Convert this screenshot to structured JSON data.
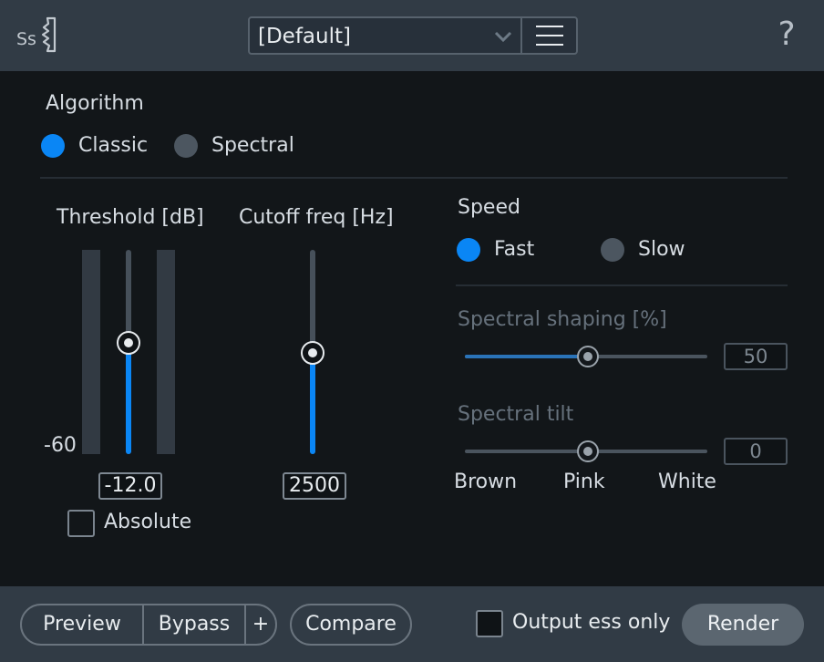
{
  "header": {
    "preset_name": "[Default]",
    "help_glyph": "?",
    "logo_icon": "de-esser-logo-icon",
    "chevron_icon": "chevron-down-icon",
    "menu_icon": "hamburger-menu-icon"
  },
  "algorithm": {
    "title": "Algorithm",
    "options": [
      {
        "label": "Classic",
        "selected": true
      },
      {
        "label": "Spectral",
        "selected": false
      }
    ]
  },
  "threshold": {
    "title": "Threshold [dB]",
    "meter_label": "-60",
    "value": "-12.0",
    "absolute_label": "Absolute",
    "absolute_checked": false
  },
  "cutoff": {
    "title": "Cutoff freq [Hz]",
    "value": "2500"
  },
  "speed": {
    "title": "Speed",
    "options": [
      {
        "label": "Fast",
        "selected": true
      },
      {
        "label": "Slow",
        "selected": false
      }
    ]
  },
  "spectral_shaping": {
    "title": "Spectral shaping [%]",
    "value": "50",
    "level_fraction": 0.5
  },
  "spectral_tilt": {
    "title": "Spectral tilt",
    "value": "0",
    "level_fraction": 0.5,
    "scale_labels": [
      "Brown",
      "Pink",
      "White"
    ]
  },
  "footer": {
    "preview_label": "Preview",
    "bypass_label": "Bypass",
    "plus_label": "+",
    "compare_label": "Compare",
    "output_ess_label": "Output ess only",
    "output_ess_checked": false,
    "render_label": "Render"
  },
  "colors": {
    "accent": "#0a86f5",
    "background": "#121619",
    "bar": "#313b45"
  }
}
